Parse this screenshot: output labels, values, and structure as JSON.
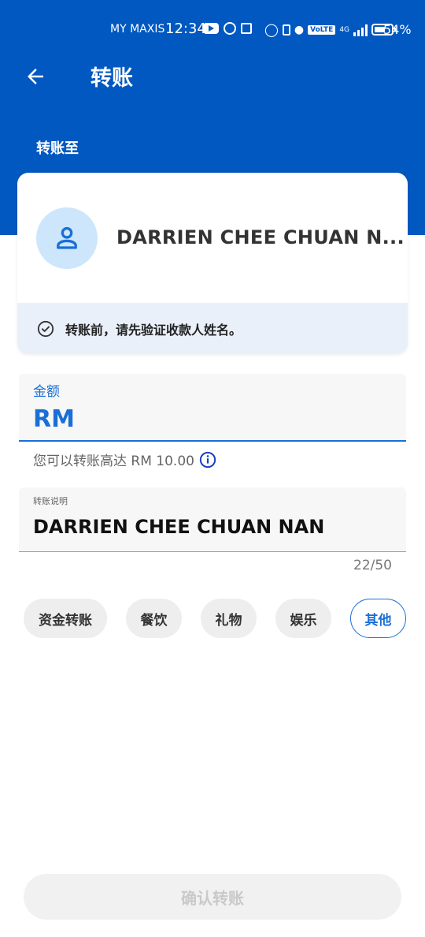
{
  "status_bar": {
    "carrier": "MY MAXIS",
    "time": "12:34",
    "volte": "VoLTE",
    "network": "4G",
    "battery": "54%"
  },
  "header": {
    "back_icon": "arrow-left-icon",
    "title": "转账"
  },
  "section_label": "转账至",
  "recipient": {
    "avatar_icon": "person-icon",
    "name": "DARRIEN CHEE CHUAN N...",
    "verify_icon": "check-circle-icon",
    "verify_notice": "转账前，请先验证收款人姓名。"
  },
  "amount": {
    "label": "金额",
    "currency_prefix": "RM",
    "limit_text": "您可以转账高达 RM 10.00",
    "info_icon": "info-icon"
  },
  "description": {
    "label": "转账说明",
    "value": "DARRIEN CHEE CHUAN NAN",
    "char_count": "22/50"
  },
  "categories": [
    {
      "label": "资金转账",
      "selected": false
    },
    {
      "label": "餐饮",
      "selected": false
    },
    {
      "label": "礼物",
      "selected": false
    },
    {
      "label": "娱乐",
      "selected": false
    },
    {
      "label": "其他",
      "selected": true
    }
  ],
  "confirm_button": "确认转账",
  "colors": {
    "brand_blue": "#0058c0",
    "accent_blue": "#1a6fd6",
    "avatar_bg": "#cde6fb",
    "notice_bg": "#eaf0fa",
    "disabled_text": "#c9c9c9"
  }
}
